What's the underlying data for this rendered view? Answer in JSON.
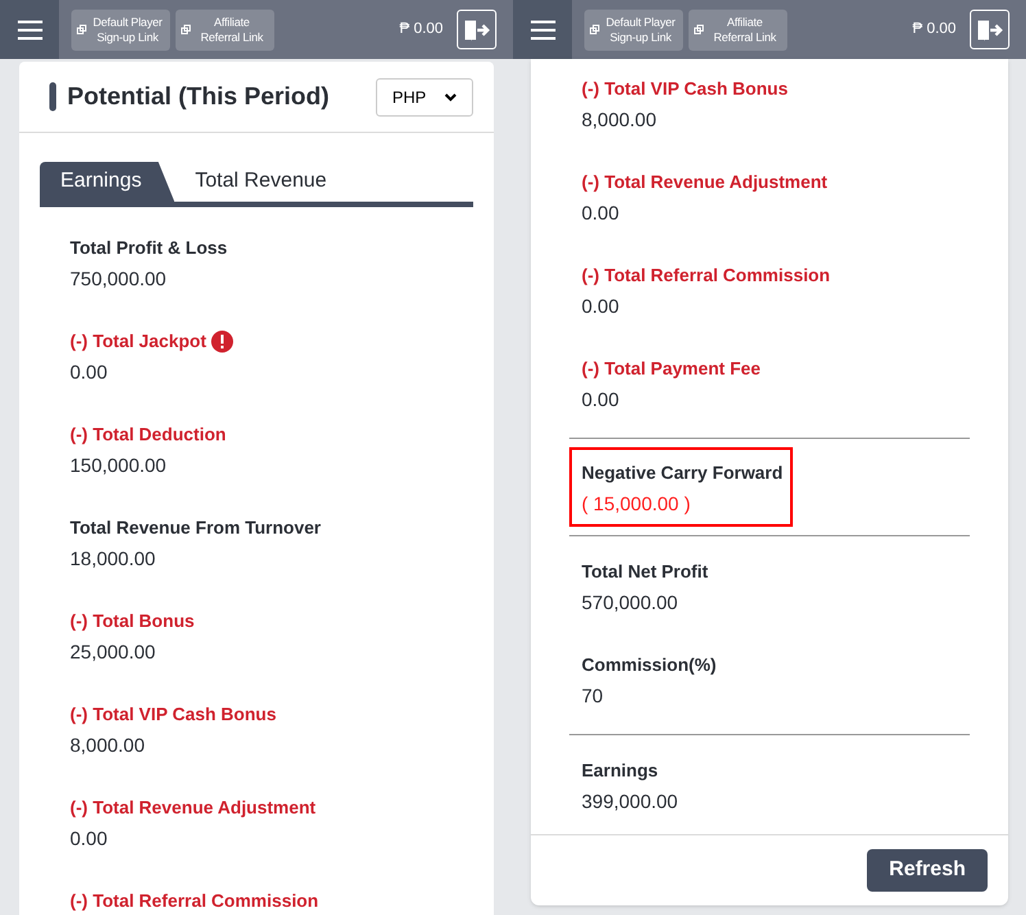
{
  "panels": [
    {
      "header": {
        "links": [
          "Default Player Sign-up Link",
          "Affiliate Referral Link"
        ],
        "balance": "₱ 0.00"
      },
      "card": {
        "title": "Potential (This Period)",
        "currency": "PHP",
        "tabs": [
          {
            "label": "Earnings",
            "selected": true
          },
          {
            "label": "Total Revenue",
            "selected": false
          }
        ],
        "items": [
          {
            "kind": "plain",
            "label": "Total Profit & Loss",
            "value": "750,000.00"
          },
          {
            "kind": "deduction",
            "label": "(-) Total Jackpot",
            "value": "0.00",
            "alert": true
          },
          {
            "kind": "deduction",
            "label": "(-) Total Deduction",
            "value": "150,000.00"
          },
          {
            "kind": "plain",
            "label": "Total Revenue From Turnover",
            "value": "18,000.00"
          },
          {
            "kind": "deduction",
            "label": "(-) Total Bonus",
            "value": "25,000.00"
          },
          {
            "kind": "deduction",
            "label": "(-) Total VIP Cash Bonus",
            "value": "8,000.00"
          },
          {
            "kind": "deduction",
            "label": "(-) Total Revenue Adjustment",
            "value": "0.00"
          },
          {
            "kind": "deduction",
            "label": "(-) Total Referral Commission"
          }
        ]
      }
    },
    {
      "header": {
        "links": [
          "Default Player Sign-up Link",
          "Affiliate Referral Link"
        ],
        "balance": "₱ 0.00"
      },
      "card": {
        "items": [
          {
            "kind": "deduction",
            "label": "(-) Total VIP Cash Bonus",
            "value": "8,000.00"
          },
          {
            "kind": "deduction",
            "label": "(-) Total Revenue Adjustment",
            "value": "0.00"
          },
          {
            "kind": "deduction",
            "label": "(-) Total Referral Commission",
            "value": "0.00"
          },
          {
            "kind": "deduction",
            "label": "(-) Total Payment Fee",
            "value": "0.00"
          },
          {
            "kind": "divider"
          },
          {
            "kind": "highlighted",
            "label": "Negative Carry Forward",
            "value": "( 15,000.00 )"
          },
          {
            "kind": "divider"
          },
          {
            "kind": "plain",
            "label": "Total Net Profit",
            "value": "570,000.00"
          },
          {
            "kind": "plain",
            "label": "Commission(%)",
            "value": "70"
          },
          {
            "kind": "divider"
          },
          {
            "kind": "plain",
            "label": "Earnings",
            "value": "399,000.00"
          }
        ],
        "button": "Refresh"
      }
    }
  ]
}
